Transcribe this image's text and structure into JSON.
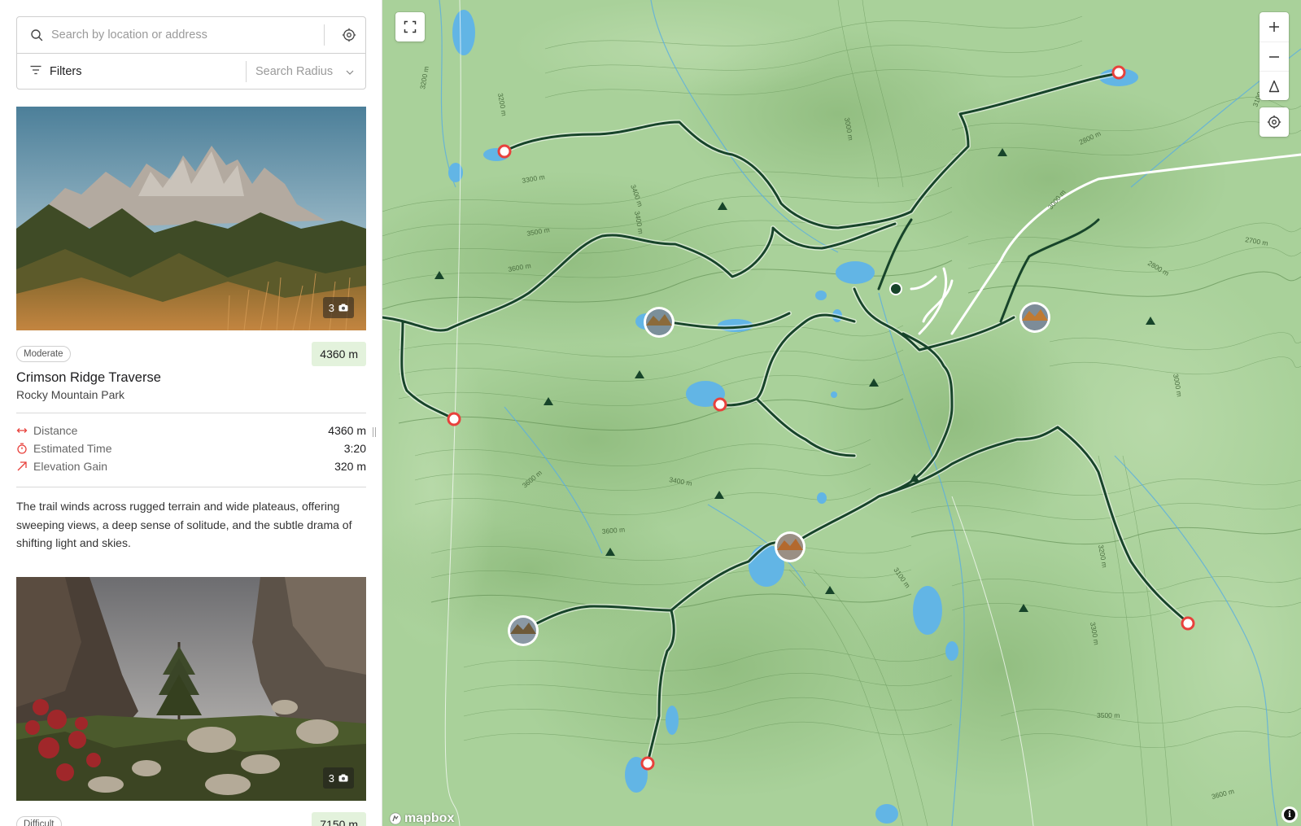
{
  "search": {
    "placeholder": "Search by location or address",
    "filters_label": "Filters",
    "radius_placeholder": "Search Radius"
  },
  "trails": [
    {
      "difficulty": "Moderate",
      "distance_badge": "4360 m",
      "name": "Crimson Ridge Traverse",
      "park": "Rocky Mountain Park",
      "photo_count": "3",
      "stats": [
        {
          "icon": "arrows-horizontal-icon",
          "label": "Distance",
          "value": "4360 m"
        },
        {
          "icon": "stopwatch-icon",
          "label": "Estimated Time",
          "value": "3:20"
        },
        {
          "icon": "arrow-up-right-icon",
          "label": "Elevation Gain",
          "value": "320 m"
        }
      ],
      "description": "The trail winds across rugged terrain and wide plateaus, offering sweeping views, a deep sense of solitude, and the subtle drama of shifting light and skies."
    },
    {
      "difficulty": "Difficult",
      "distance_badge": "7150 m",
      "photo_count": "3"
    }
  ],
  "map": {
    "contour_labels": [
      "3200 m",
      "3300 m",
      "3400 m",
      "3500 m",
      "3600 m",
      "3100 m",
      "3000 m",
      "2800 m",
      "2700 m",
      "3500 m",
      "3600 m",
      "3400 m",
      "3600 m",
      "3100 m",
      "3200 m",
      "3300 m",
      "3600 m",
      "3300 m",
      "3000 m",
      "2800 m"
    ],
    "attribution_logo": "mapbox",
    "colors": {
      "land": "#a9d19a",
      "route": "#17442a",
      "endpoint": "#e8413c",
      "water": "#62b5e5"
    }
  }
}
